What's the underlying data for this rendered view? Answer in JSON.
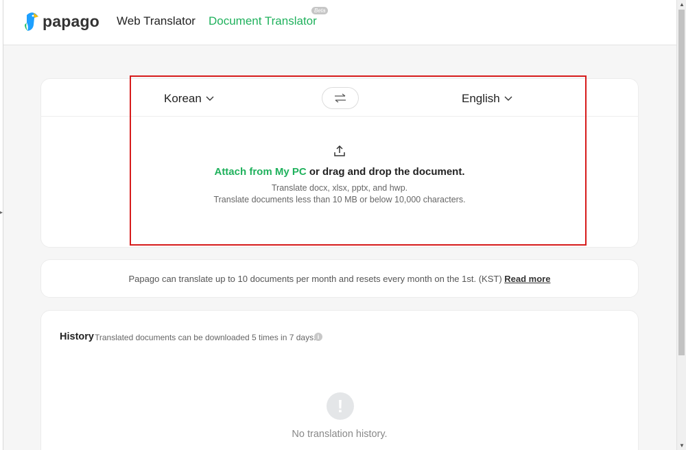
{
  "header": {
    "logo_text": "papago",
    "nav": {
      "web": "Web Translator",
      "doc": "Document Translator",
      "beta": "Beta"
    }
  },
  "translator": {
    "source_lang": "Korean",
    "target_lang": "English",
    "attach_link": "Attach from My PC",
    "attach_rest": " or drag and drop the document.",
    "hint_formats": "Translate docx, xlsx, pptx, and hwp.",
    "hint_limits": "Translate documents less than 10 MB or below 10,000 characters."
  },
  "notice": {
    "text": "Papago can translate up to 10 documents per month and resets every month on the 1st. (KST) ",
    "read_more": "Read more"
  },
  "history": {
    "title": "History",
    "desc": "Translated documents can be downloaded 5 times in 7 days.",
    "empty": "No translation history."
  },
  "colors": {
    "brand_green": "#1fb15c",
    "highlight_red": "#d61a1a"
  }
}
